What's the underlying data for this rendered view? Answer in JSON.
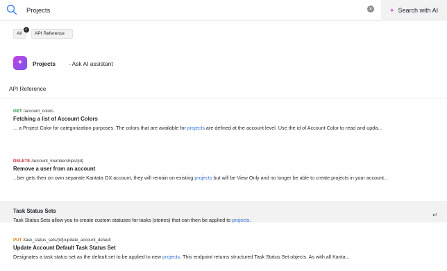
{
  "search": {
    "value": "Projects",
    "ai_button_label": "Search with AI"
  },
  "filters": {
    "all_label": "All",
    "api_label": "API Reference"
  },
  "assistant": {
    "title": "Projects",
    "suffix": "- Ask AI assistant"
  },
  "section": {
    "label": "API Reference"
  },
  "results": [
    {
      "method": "GET",
      "path": "/account_colors",
      "title": "Fetching a list of Account Colors",
      "snippet_before": "... a Project Color for categorization purposes. The colors that are available for ",
      "snippet_highlight": "projects",
      "snippet_after": " are defined at the account level. Use the id of Account Color to read and upda..."
    },
    {
      "method": "DELETE",
      "path": "/account_memberships/{id}",
      "title": "Remove a user from an account",
      "snippet_before": "...ber gets their on own separate Kantata OX account, they will remain on existing ",
      "snippet_highlight": "projects",
      "snippet_after": " but will be View Only and no longer be able to create projects in your account..."
    },
    {
      "title": "Task Status Sets",
      "snippet_before": "Task Status Sets allow you to create custom statuses for tasks (stories) that can then be applied to ",
      "snippet_highlight": "projects",
      "snippet_after": "."
    },
    {
      "method": "PUT",
      "path": "/task_status_sets/{id}/update_account_default",
      "title": "Update Account Default Task Status Set",
      "snippet_before": "Designates a task status set as the default set to be applied to new ",
      "snippet_highlight": "projects",
      "snippet_after": ". This endpoint returns structured Task Status Set objects. As with all Kanta..."
    }
  ],
  "icons": {
    "search": "search-icon",
    "clear": "clear-icon",
    "sparkle": "sparkle-icon",
    "enter": "enter-icon"
  },
  "colors": {
    "accent_link": "#2f6fd6",
    "get": "#1a8f3c",
    "delete": "#d12a3a",
    "put": "#d97a0b"
  }
}
